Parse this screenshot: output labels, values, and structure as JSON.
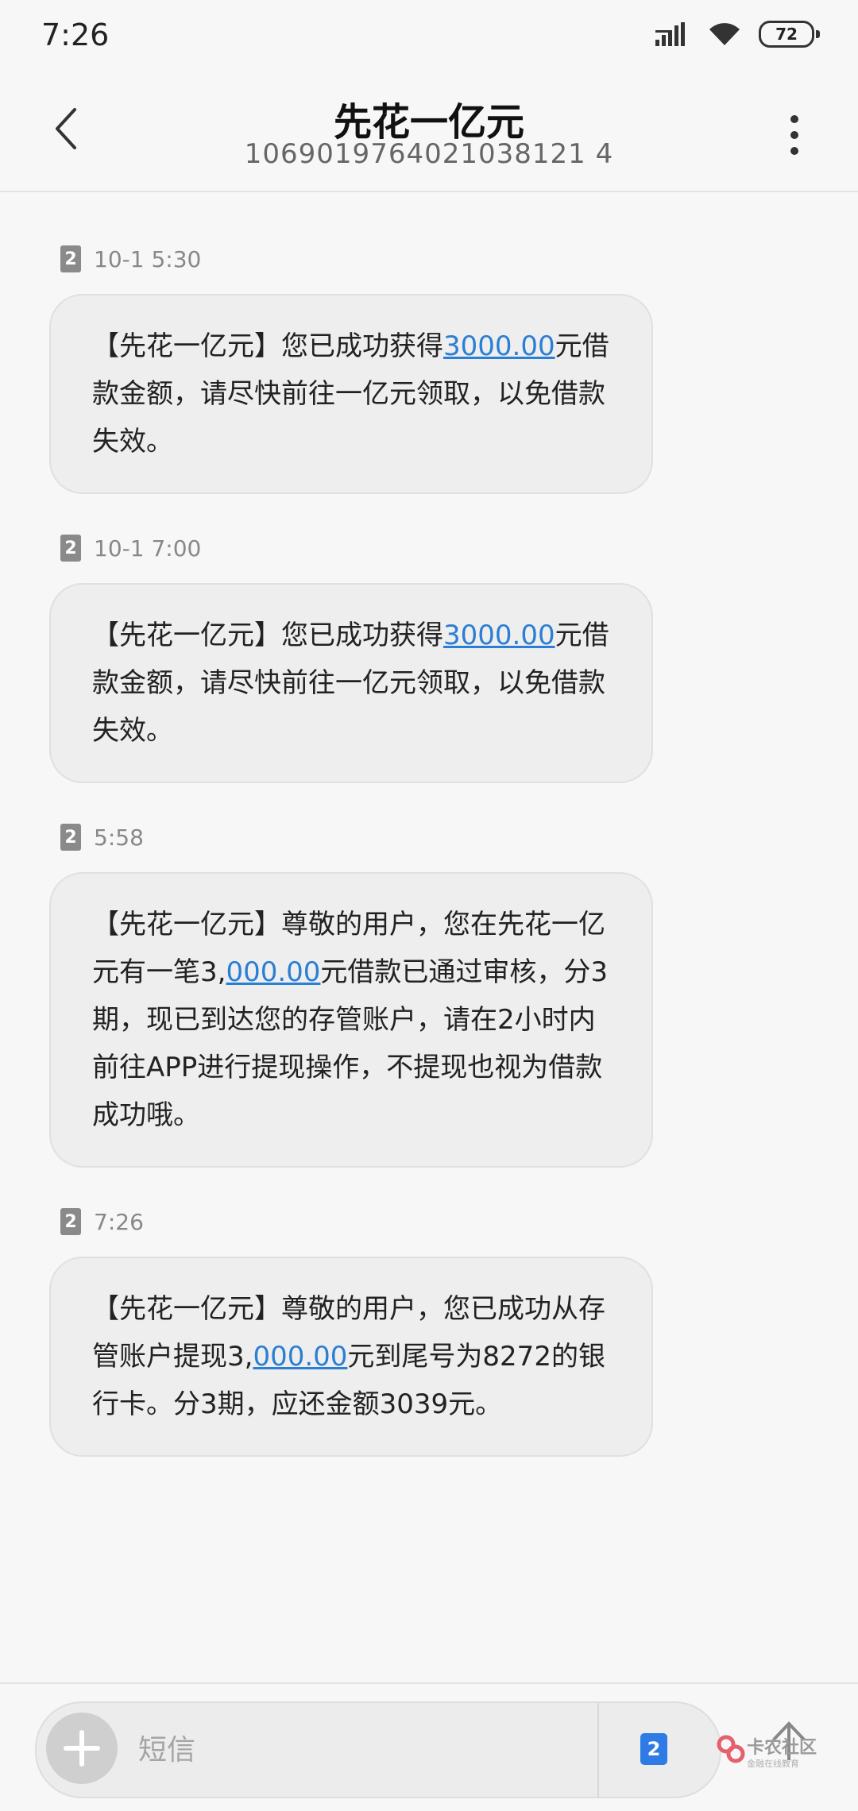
{
  "status_bar": {
    "time": "7:26",
    "battery": "72",
    "signal_icon": "cellular-signal-icon",
    "wifi_icon": "wifi-icon"
  },
  "header": {
    "title": "先花一亿元",
    "number": "1069019764021038121 4",
    "back_icon": "back-chevron-icon",
    "more_icon": "more-vertical-icon"
  },
  "messages": [
    {
      "sim": "2",
      "time": "10-1 5:30",
      "before": "【先花一亿元】您已成功获得",
      "link": "3000.00",
      "after": "元借款金额，请尽快前往一亿元领取，以免借款失效。"
    },
    {
      "sim": "2",
      "time": "10-1 7:00",
      "before": "【先花一亿元】您已成功获得",
      "link": "3000.00",
      "after": "元借款金额，请尽快前往一亿元领取，以免借款失效。"
    },
    {
      "sim": "2",
      "time": "5:58",
      "before": "【先花一亿元】尊敬的用户，您在先花一亿元有一笔3,",
      "link": "000.00",
      "after": "元借款已通过审核，分3期，现已到达您的存管账户，请在2小时内前往APP进行提现操作，不提现也视为借款成功哦。"
    },
    {
      "sim": "2",
      "time": "7:26",
      "before": "【先花一亿元】尊敬的用户，您已成功从存管账户提现3,",
      "link": "000.00",
      "after": "元到尾号为8272的银行卡。分3期，应还金额3039元。"
    }
  ],
  "composer": {
    "placeholder": "短信",
    "sim": "2",
    "add_icon": "plus-icon"
  },
  "watermark": {
    "text": "卡农社区",
    "sub": "金融在线教育"
  },
  "colors": {
    "link": "#2a7fd4",
    "bubble": "#eeeeee",
    "sim_send": "#2f7be6"
  }
}
